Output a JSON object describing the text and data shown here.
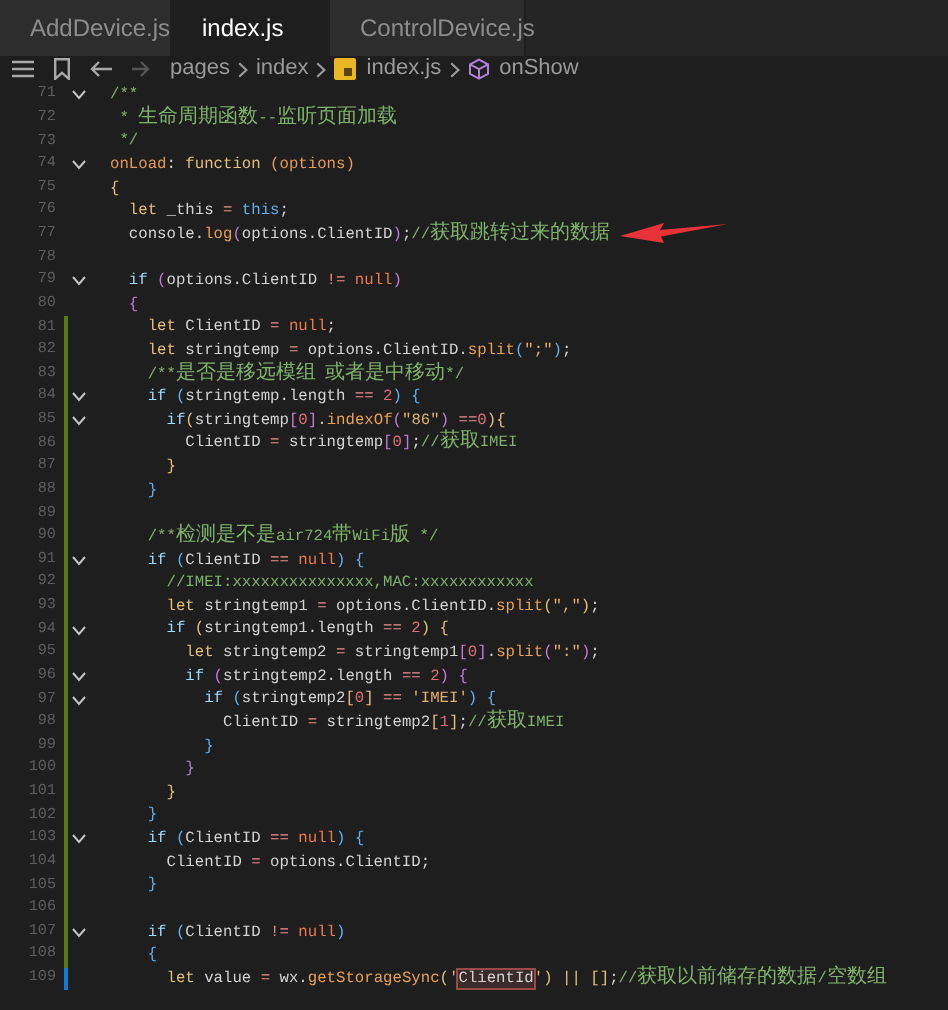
{
  "tabs": [
    {
      "label": "AddDevice.js",
      "selected": false
    },
    {
      "label": "index.js",
      "selected": true
    },
    {
      "label": "ControlDevice.js",
      "selected": false
    }
  ],
  "breadcrumb": [
    {
      "text": "pages",
      "kind": "folder"
    },
    {
      "text": "index",
      "kind": "folder"
    },
    {
      "text": "index.js",
      "kind": "file"
    },
    {
      "text": "onShow",
      "kind": "symbol"
    }
  ],
  "editor": {
    "lines": [
      {
        "number": "71",
        "fold": true,
        "tokens": [
          {
            "text": "/**",
            "kind": "comment"
          }
        ]
      },
      {
        "number": "72",
        "fold": false,
        "tokens": [
          {
            "text": " * 生命周期函数--监听页面加载",
            "kind": "comment"
          }
        ]
      },
      {
        "number": "73",
        "fold": false,
        "tokens": [
          {
            "text": " */",
            "kind": "comment"
          }
        ]
      },
      {
        "number": "74",
        "fold": true,
        "tokens": [
          {
            "text": "onLoad",
            "kind": "name"
          },
          {
            "text": ": ",
            "kind": "plain"
          },
          {
            "text": "function",
            "kind": "keyword"
          },
          {
            "text": " (options)",
            "kind": "name"
          }
        ]
      },
      {
        "number": "75",
        "fold": false,
        "tokens": [
          {
            "text": "{",
            "kind": "bracket1"
          }
        ]
      },
      {
        "number": "76",
        "fold": false,
        "tokens": [
          {
            "text": "  let",
            "kind": "keyword"
          },
          {
            "text": " _this ",
            "kind": "plain"
          },
          {
            "text": "=",
            "kind": "operator"
          },
          {
            "text": " this",
            "kind": "this"
          },
          {
            "text": ";",
            "kind": "plain"
          }
        ]
      },
      {
        "number": "77",
        "fold": false,
        "arrow": true,
        "tokens": [
          {
            "text": "  console.",
            "kind": "plain"
          },
          {
            "text": "log",
            "kind": "method"
          },
          {
            "text": "(",
            "kind": "bracket2"
          },
          {
            "text": "options.ClientID",
            "kind": "plain"
          },
          {
            "text": ")",
            "kind": "bracket2"
          },
          {
            "text": ";",
            "kind": "plain"
          },
          {
            "text": "//获取跳转过来的数据",
            "kind": "comment"
          }
        ]
      },
      {
        "number": "78",
        "fold": false
      },
      {
        "number": "79",
        "fold": true,
        "tokens": [
          {
            "text": "  if",
            "kind": "control"
          },
          {
            "text": " (",
            "kind": "bracket2"
          },
          {
            "text": "options.ClientID ",
            "kind": "plain"
          },
          {
            "text": "!=",
            "kind": "operator"
          },
          {
            "text": " null",
            "kind": "constant"
          },
          {
            "text": ")",
            "kind": "bracket2"
          }
        ]
      },
      {
        "number": "80",
        "fold": false,
        "tokens": [
          {
            "text": "  {",
            "kind": "bracket2"
          }
        ]
      },
      {
        "number": "81",
        "fold": false,
        "color": "#587c0c",
        "tokens": [
          {
            "text": "    let",
            "kind": "keyword"
          },
          {
            "text": " ClientID ",
            "kind": "plain"
          },
          {
            "text": "=",
            "kind": "operator"
          },
          {
            "text": " null",
            "kind": "constant"
          },
          {
            "text": ";",
            "kind": "plain"
          }
        ]
      },
      {
        "number": "82",
        "fold": false,
        "color": "#587c0c",
        "tokens": [
          {
            "text": "    let",
            "kind": "keyword"
          },
          {
            "text": " stringtemp ",
            "kind": "plain"
          },
          {
            "text": "=",
            "kind": "operator"
          },
          {
            "text": " options.ClientID.",
            "kind": "plain"
          },
          {
            "text": "split",
            "kind": "method"
          },
          {
            "text": "(",
            "kind": "bracket3"
          },
          {
            "text": "\";\"",
            "kind": "string"
          },
          {
            "text": ")",
            "kind": "bracket3"
          },
          {
            "text": ";",
            "kind": "plain"
          }
        ]
      },
      {
        "number": "83",
        "fold": false,
        "color": "#587c0c",
        "tokens": [
          {
            "text": "    /**是否是移远模组 或者是中移动*/",
            "kind": "comment"
          }
        ]
      },
      {
        "number": "84",
        "fold": true,
        "color": "#587c0c",
        "tokens": [
          {
            "text": "    if",
            "kind": "control"
          },
          {
            "text": " (",
            "kind": "bracket3"
          },
          {
            "text": "stringtemp.length ",
            "kind": "plain"
          },
          {
            "text": "==",
            "kind": "operator"
          },
          {
            "text": " 2",
            "kind": "number"
          },
          {
            "text": ")",
            "kind": "bracket3"
          },
          {
            "text": " {",
            "kind": "bracket3"
          }
        ]
      },
      {
        "number": "85",
        "fold": true,
        "color": "#587c0c",
        "tokens": [
          {
            "text": "      if",
            "kind": "control"
          },
          {
            "text": "(",
            "kind": "bracket1"
          },
          {
            "text": "stringtemp",
            "kind": "plain"
          },
          {
            "text": "[",
            "kind": "bracket2"
          },
          {
            "text": "0",
            "kind": "number"
          },
          {
            "text": "]",
            "kind": "bracket2"
          },
          {
            "text": ".",
            "kind": "plain"
          },
          {
            "text": "indexOf",
            "kind": "method"
          },
          {
            "text": "(",
            "kind": "bracket2"
          },
          {
            "text": "\"86\"",
            "kind": "string"
          },
          {
            "text": ")",
            "kind": "bracket2"
          },
          {
            "text": " ==",
            "kind": "operator"
          },
          {
            "text": "0",
            "kind": "number"
          },
          {
            "text": ")",
            "kind": "bracket1"
          },
          {
            "text": "{",
            "kind": "bracket1"
          }
        ]
      },
      {
        "number": "86",
        "fold": false,
        "color": "#587c0c",
        "tokens": [
          {
            "text": "        ClientID ",
            "kind": "plain"
          },
          {
            "text": "=",
            "kind": "operator"
          },
          {
            "text": " stringtemp",
            "kind": "plain"
          },
          {
            "text": "[",
            "kind": "bracket2"
          },
          {
            "text": "0",
            "kind": "number"
          },
          {
            "text": "]",
            "kind": "bracket2"
          },
          {
            "text": ";",
            "kind": "plain"
          },
          {
            "text": "//获取IMEI",
            "kind": "comment"
          }
        ]
      },
      {
        "number": "87",
        "fold": false,
        "color": "#587c0c",
        "tokens": [
          {
            "text": "      }",
            "kind": "bracket1"
          }
        ]
      },
      {
        "number": "88",
        "fold": false,
        "color": "#587c0c",
        "tokens": [
          {
            "text": "    }",
            "kind": "bracket3"
          }
        ]
      },
      {
        "number": "89",
        "fold": false,
        "color": "#587c0c"
      },
      {
        "number": "90",
        "fold": false,
        "color": "#587c0c",
        "tokens": [
          {
            "text": "    /**检测是不是air724带WiFi版 */",
            "kind": "comment"
          }
        ]
      },
      {
        "number": "91",
        "fold": true,
        "color": "#587c0c",
        "tokens": [
          {
            "text": "    if",
            "kind": "control"
          },
          {
            "text": " (",
            "kind": "bracket3"
          },
          {
            "text": "ClientID ",
            "kind": "plain"
          },
          {
            "text": "==",
            "kind": "operator"
          },
          {
            "text": " null",
            "kind": "constant"
          },
          {
            "text": ")",
            "kind": "bracket3"
          },
          {
            "text": " {",
            "kind": "bracket3"
          }
        ]
      },
      {
        "number": "92",
        "fold": false,
        "color": "#587c0c",
        "tokens": [
          {
            "text": "      //IMEI:xxxxxxxxxxxxxxx,MAC:xxxxxxxxxxxx",
            "kind": "comment"
          }
        ]
      },
      {
        "number": "93",
        "fold": false,
        "color": "#587c0c",
        "tokens": [
          {
            "text": "      let",
            "kind": "keyword"
          },
          {
            "text": " stringtemp1 ",
            "kind": "plain"
          },
          {
            "text": "=",
            "kind": "operator"
          },
          {
            "text": " options.ClientID.",
            "kind": "plain"
          },
          {
            "text": "split",
            "kind": "method"
          },
          {
            "text": "(",
            "kind": "bracket1"
          },
          {
            "text": "\",\"",
            "kind": "string"
          },
          {
            "text": ")",
            "kind": "bracket1"
          },
          {
            "text": ";",
            "kind": "plain"
          }
        ]
      },
      {
        "number": "94",
        "fold": true,
        "color": "#587c0c",
        "tokens": [
          {
            "text": "      if",
            "kind": "control"
          },
          {
            "text": " (",
            "kind": "bracket1"
          },
          {
            "text": "stringtemp1.length ",
            "kind": "plain"
          },
          {
            "text": "==",
            "kind": "operator"
          },
          {
            "text": " 2",
            "kind": "number"
          },
          {
            "text": ")",
            "kind": "bracket1"
          },
          {
            "text": " {",
            "kind": "bracket1"
          }
        ]
      },
      {
        "number": "95",
        "fold": false,
        "color": "#587c0c",
        "tokens": [
          {
            "text": "        let",
            "kind": "keyword"
          },
          {
            "text": " stringtemp2 ",
            "kind": "plain"
          },
          {
            "text": "=",
            "kind": "operator"
          },
          {
            "text": " stringtemp1",
            "kind": "plain"
          },
          {
            "text": "[",
            "kind": "bracket2"
          },
          {
            "text": "0",
            "kind": "number"
          },
          {
            "text": "]",
            "kind": "bracket2"
          },
          {
            "text": ".",
            "kind": "plain"
          },
          {
            "text": "split",
            "kind": "method"
          },
          {
            "text": "(",
            "kind": "bracket2"
          },
          {
            "text": "\":\"",
            "kind": "string"
          },
          {
            "text": ")",
            "kind": "bracket2"
          },
          {
            "text": ";",
            "kind": "plain"
          }
        ]
      },
      {
        "number": "96",
        "fold": true,
        "color": "#587c0c",
        "tokens": [
          {
            "text": "        if",
            "kind": "control"
          },
          {
            "text": " (",
            "kind": "bracket2"
          },
          {
            "text": "stringtemp2.length ",
            "kind": "plain"
          },
          {
            "text": "==",
            "kind": "operator"
          },
          {
            "text": " 2",
            "kind": "number"
          },
          {
            "text": ")",
            "kind": "bracket2"
          },
          {
            "text": " {",
            "kind": "bracket2"
          }
        ]
      },
      {
        "number": "97",
        "fold": true,
        "color": "#587c0c",
        "tokens": [
          {
            "text": "          if",
            "kind": "control"
          },
          {
            "text": " (",
            "kind": "bracket3"
          },
          {
            "text": "stringtemp2",
            "kind": "plain"
          },
          {
            "text": "[",
            "kind": "bracket1"
          },
          {
            "text": "0",
            "kind": "number"
          },
          {
            "text": "]",
            "kind": "bracket1"
          },
          {
            "text": " ==",
            "kind": "operator"
          },
          {
            "text": " 'IMEI'",
            "kind": "string"
          },
          {
            "text": ")",
            "kind": "bracket3"
          },
          {
            "text": " {",
            "kind": "bracket3"
          }
        ]
      },
      {
        "number": "98",
        "fold": false,
        "color": "#587c0c",
        "tokens": [
          {
            "text": "            ClientID ",
            "kind": "plain"
          },
          {
            "text": "=",
            "kind": "operator"
          },
          {
            "text": " stringtemp2",
            "kind": "plain"
          },
          {
            "text": "[",
            "kind": "bracket1"
          },
          {
            "text": "1",
            "kind": "number"
          },
          {
            "text": "]",
            "kind": "bracket1"
          },
          {
            "text": ";",
            "kind": "plain"
          },
          {
            "text": "//获取IMEI",
            "kind": "comment"
          }
        ]
      },
      {
        "number": "99",
        "fold": false,
        "color": "#587c0c",
        "tokens": [
          {
            "text": "          }",
            "kind": "bracket3"
          }
        ]
      },
      {
        "number": "100",
        "fold": false,
        "color": "#587c0c",
        "tokens": [
          {
            "text": "        }",
            "kind": "bracket2"
          }
        ]
      },
      {
        "number": "101",
        "fold": false,
        "color": "#587c0c",
        "tokens": [
          {
            "text": "      }",
            "kind": "bracket1"
          }
        ]
      },
      {
        "number": "102",
        "fold": false,
        "color": "#587c0c",
        "tokens": [
          {
            "text": "    }",
            "kind": "bracket3"
          }
        ]
      },
      {
        "number": "103",
        "fold": true,
        "color": "#587c0c",
        "tokens": [
          {
            "text": "    if",
            "kind": "control"
          },
          {
            "text": " (",
            "kind": "bracket3"
          },
          {
            "text": "ClientID ",
            "kind": "plain"
          },
          {
            "text": "==",
            "kind": "operator"
          },
          {
            "text": " null",
            "kind": "constant"
          },
          {
            "text": ")",
            "kind": "bracket3"
          },
          {
            "text": " {",
            "kind": "bracket3"
          }
        ]
      },
      {
        "number": "104",
        "fold": false,
        "color": "#587c0c",
        "tokens": [
          {
            "text": "      ClientID ",
            "kind": "plain"
          },
          {
            "text": "=",
            "kind": "operator"
          },
          {
            "text": " options.ClientID;",
            "kind": "plain"
          }
        ]
      },
      {
        "number": "105",
        "fold": false,
        "color": "#587c0c",
        "tokens": [
          {
            "text": "    }",
            "kind": "bracket3"
          }
        ]
      },
      {
        "number": "106",
        "fold": false,
        "color": "#587c0c"
      },
      {
        "number": "107",
        "fold": true,
        "color": "#587c0c",
        "tokens": [
          {
            "text": "    if",
            "kind": "control"
          },
          {
            "text": " (",
            "kind": "bracket3"
          },
          {
            "text": "ClientID ",
            "kind": "plain"
          },
          {
            "text": "!=",
            "kind": "operator"
          },
          {
            "text": " null",
            "kind": "constant"
          },
          {
            "text": ")",
            "kind": "bracket3"
          }
        ]
      },
      {
        "number": "108",
        "fold": false,
        "color": "#587c0c",
        "tokens": [
          {
            "text": "    {",
            "kind": "bracket3"
          }
        ]
      },
      {
        "number": "109",
        "fold": false,
        "color": "#0c7dd1",
        "tokens": [
          {
            "text": "      let",
            "kind": "keyword"
          },
          {
            "text": " value ",
            "kind": "plain"
          },
          {
            "text": "=",
            "kind": "operator"
          },
          {
            "text": " wx.",
            "kind": "plain"
          },
          {
            "text": "getStorageSync",
            "kind": "method"
          },
          {
            "text": "(",
            "kind": "bracket1"
          },
          {
            "text": "'",
            "kind": "string"
          },
          {
            "text": "ClientId",
            "kind": "match"
          },
          {
            "text": "'",
            "kind": "string"
          },
          {
            "text": ")",
            "kind": "bracket1"
          },
          {
            "text": " ||",
            "kind": "bracket1"
          },
          {
            "text": " []",
            "kind": "bracket1"
          },
          {
            "text": ";",
            "kind": "plain"
          },
          {
            "text": "//获取以前储存的数据/空数组",
            "kind": "comment"
          }
        ]
      }
    ]
  }
}
